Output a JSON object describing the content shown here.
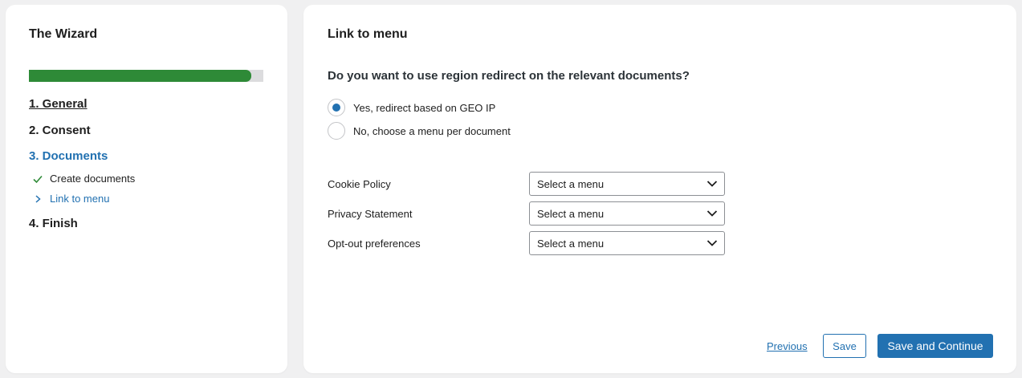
{
  "wizard": {
    "title": "The Wizard",
    "progress": 0.95,
    "progress_color": "#2e8a37",
    "steps": [
      {
        "label": "1. General",
        "state": "done"
      },
      {
        "label": "2. Consent",
        "state": "done"
      },
      {
        "label": "3. Documents",
        "state": "active",
        "substeps": [
          {
            "label": "Create documents",
            "icon": "check-icon",
            "state": "done"
          },
          {
            "label": "Link to menu",
            "icon": "chevron-right-icon",
            "state": "active"
          }
        ]
      },
      {
        "label": "4. Finish",
        "state": "pending"
      }
    ]
  },
  "main": {
    "title": "Link to menu",
    "question": "Do you want to use region redirect on the relevant documents?",
    "options": [
      {
        "label": "Yes, redirect based on GEO IP",
        "selected": true
      },
      {
        "label": "No, choose a menu per document",
        "selected": false
      }
    ],
    "fields": [
      {
        "label": "Cookie Policy",
        "value": "Select a menu"
      },
      {
        "label": "Privacy Statement",
        "value": "Select a menu"
      },
      {
        "label": "Opt-out preferences",
        "value": "Select a menu"
      }
    ],
    "actions": {
      "previous": "Previous",
      "save": "Save",
      "save_continue": "Save and Continue"
    },
    "accent_color": "#2271b1"
  }
}
